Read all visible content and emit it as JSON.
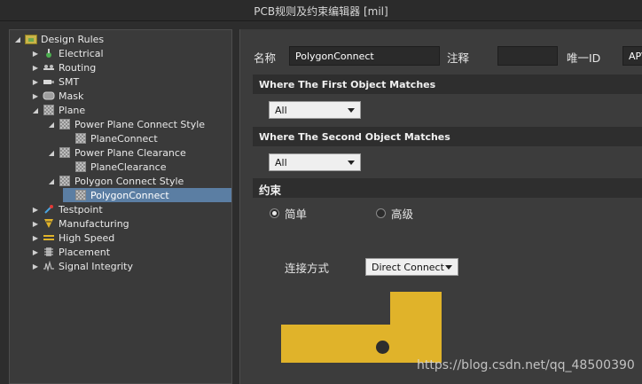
{
  "window": {
    "title": "PCB规则及约束编辑器 [mil]"
  },
  "tree": {
    "items": [
      {
        "label": "Design Rules",
        "expanded": true
      },
      {
        "label": "Electrical"
      },
      {
        "label": "Routing"
      },
      {
        "label": "SMT"
      },
      {
        "label": "Mask"
      },
      {
        "label": "Plane",
        "expanded": true
      },
      {
        "label": "Power Plane Connect Style",
        "expanded": true
      },
      {
        "label": "PlaneConnect"
      },
      {
        "label": "Power Plane Clearance",
        "expanded": true
      },
      {
        "label": "PlaneClearance"
      },
      {
        "label": "Polygon Connect Style",
        "expanded": true
      },
      {
        "label": "PolygonConnect",
        "selected": true
      },
      {
        "label": "Testpoint"
      },
      {
        "label": "Manufacturing"
      },
      {
        "label": "High Speed"
      },
      {
        "label": "Placement"
      },
      {
        "label": "Signal Integrity"
      }
    ]
  },
  "header": {
    "name_label": "名称",
    "name_value": "PolygonConnect",
    "comment_label": "注释",
    "comment_value": "",
    "uid_label": "唯一ID",
    "uid_value": "APV"
  },
  "first_match": {
    "title": "Where The First Object Matches",
    "selected": "All"
  },
  "second_match": {
    "title": "Where The Second Object Matches",
    "selected": "All"
  },
  "constraints": {
    "title": "约束",
    "mode_simple": "简单",
    "mode_advanced": "高级",
    "selected_mode": "simple",
    "connect_label": "连接方式",
    "connect_value": "Direct Connect"
  },
  "watermark": "https://blog.csdn.net/qq_48500390",
  "colors": {
    "selection": "#5b7ea3",
    "polygon": "#e0b32a",
    "panel": "#3c3c3c"
  }
}
